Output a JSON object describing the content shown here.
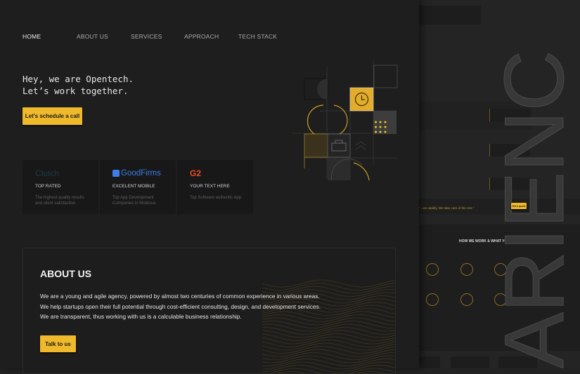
{
  "nav": {
    "items": [
      {
        "label": "HOME"
      },
      {
        "label": "ABOUT US"
      },
      {
        "label": "SERVICES"
      },
      {
        "label": "APPROACH"
      },
      {
        "label": "TECH STACK"
      }
    ]
  },
  "hero": {
    "line1": "Hey, we are Opentech.",
    "line2": "Let’s work together.",
    "cta": "Let's schedule a call"
  },
  "cards": [
    {
      "logo": "Clutch",
      "title": "TOP RATED",
      "desc": "The highest quality results and client satisfaction"
    },
    {
      "logo": "GoodFirms",
      "title": "EXCELENT MOBILE",
      "desc": "Top App Development Companies in Moldova"
    },
    {
      "logo": "G2",
      "title": "YOUR TEXT HERE",
      "desc": "Top Software authentic App"
    }
  ],
  "about": {
    "title": "ABOUT US",
    "lines": [
      "We are a young and agile agency, powered by almost two centuries of common experience in various areas.",
      "We help startups open their full potential through cost-efficient consulting, design, and development services.",
      "We are transparent, thus working with us is a calculable business relationship."
    ],
    "cta": "Talk to us"
  },
  "preview": {
    "heading": "HOW WE WORK & WHAT YOU GET",
    "quote": "\"...we rapidly. We take care of the rest.\"",
    "quote_button": "Get a quote",
    "side_text": "ARIENC"
  },
  "colors": {
    "accent": "#f0b92c",
    "bg": "#1e1e1e"
  }
}
